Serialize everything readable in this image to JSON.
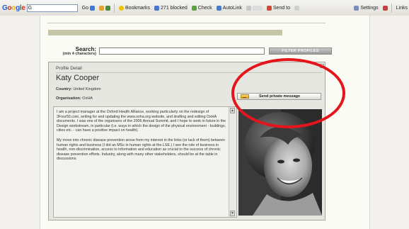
{
  "toolbar": {
    "logo_letters": [
      "G",
      "o",
      "o",
      "g",
      "l",
      "e"
    ],
    "search_value": "G",
    "go_label": "Go",
    "bookmarks_label": "Bookmarks",
    "blocked_label": "271 blocked",
    "check_label": "Check",
    "autolink_label": "AutoLink",
    "sendto_label": "Send to",
    "settings_label": "Settings",
    "links_label": "Links"
  },
  "search": {
    "label": "Search:",
    "hint": "(min 4 characters)",
    "value": "",
    "button_label": "FILTER PROFILES"
  },
  "profile": {
    "section_label": "Profile Detail",
    "name": "Katy Cooper",
    "country_label": "Country:",
    "country_value": "United Kingdom",
    "org_label": "Organisation:",
    "org_value": "OxHA",
    "message_button_label": "Send private message",
    "bio_paragraphs": [
      "I am a project manager at the Oxford Health Alliance, working particularly on the redesign of 3Four50.com, writing for and updating the www.oxha.org website, and drafting and editing OxHA documents. I was one of the organisers of the 2006 Annual Summit, and I hope to work in future in the Design workstream, in particular (i.e. ways in which the design of the physical environment - buildings, cities etc. - can have a positive impact on health).",
      "My move into chronic disease prevention arose from my interest in the links (or lack of them) between human rights and business (I did an MSc in human rights at the LSE.) I see the role of business in health, non-discrimination, access to information and education as crucial to the success of chronic disease prevention efforts. Industry, along with many other stakeholders, should be at the table in discussions."
    ]
  },
  "colors": {
    "annotation": "#e4161b",
    "olive_bar": "#c5c6a6",
    "panel_bg": "#e7e7e2"
  }
}
